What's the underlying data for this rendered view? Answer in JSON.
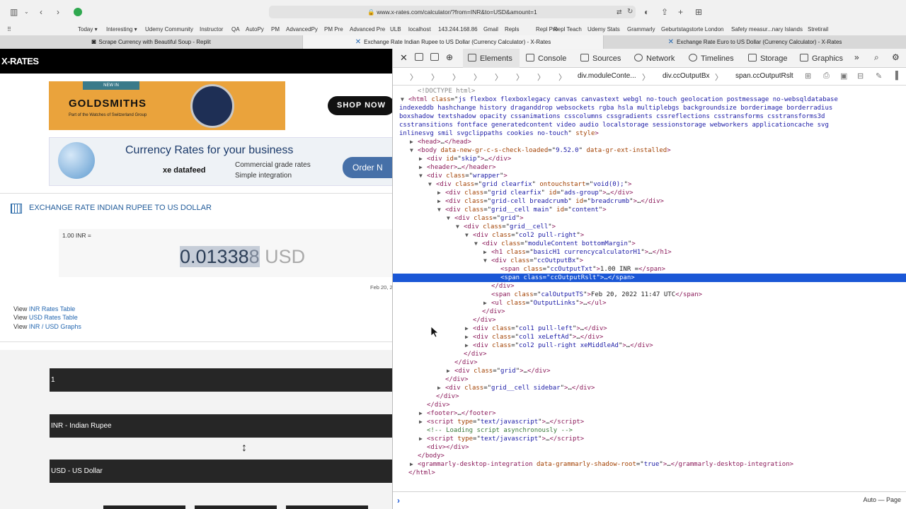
{
  "browser": {
    "url": "www.x-rates.com/calculator/?from=INR&to=USD&amount=1",
    "bookmarks": [
      "Today",
      "Interesting",
      "Udemy Community",
      "Instructor",
      "QA",
      "AutoPy",
      "PM",
      "AdvancedPy",
      "PM Pre",
      "Advanced Pre",
      "ULB",
      "localhost",
      "143.244.168.86",
      "Gmail",
      "Repls",
      "Repl Pro",
      "Repl Teach",
      "Udemy Stats",
      "Grammarly",
      "Geburtstagstorte London",
      "Safety measur...nary Islands",
      "Stretirail"
    ],
    "tabs": [
      {
        "title": "Scrape Currency with Beautiful Soup - Replit"
      },
      {
        "title": "Exchange Rate Indian Rupee to US Dollar (Currency Calculator) - X-Rates"
      },
      {
        "title": "Exchange Rate Euro to US Dollar (Currency Calculator) - X-Rates"
      }
    ]
  },
  "page": {
    "logo": "X-RATES",
    "ad1": {
      "newin": "NEW IN",
      "brand": "GOLDSMITHS",
      "sub": "Part of the Watches of Switzerland Group",
      "cta": "SHOP NOW"
    },
    "ad2": {
      "title": "Currency Rates for your business",
      "brand": "xe datafeed",
      "bullet1": "Commercial grade rates",
      "bullet2": "Simple integration",
      "cta": "Order N"
    },
    "title": "EXCHANGE RATE INDIAN RUPEE TO US DOLLAR",
    "output_txt": "1.00 INR =",
    "output_value_main": "0.01338",
    "output_value_tail": "8",
    "output_currency": "USD",
    "timestamp": "Feb 20, 2",
    "links": [
      {
        "prefix": "View ",
        "text": "INR Rates Table"
      },
      {
        "prefix": "View ",
        "text": "USD Rates Table"
      },
      {
        "prefix": "View ",
        "text": "INR / USD Graphs"
      }
    ],
    "amount": "1",
    "from": "INR - Indian Rupee",
    "to": "USD - US Dollar"
  },
  "devtools": {
    "tabs": [
      "Elements",
      "Console",
      "Sources",
      "Network",
      "Timelines",
      "Storage",
      "Graphics"
    ],
    "breadcrumbs": [
      "div.moduleConte...",
      "div.ccOutputBx",
      "span.ccOutputRslt"
    ],
    "console_mode": "Auto — Page",
    "dom_lines": [
      {
        "indent": 2,
        "tri": "",
        "html": "<span class='dt'>&lt;!DOCTYPE html&gt;</span>"
      },
      {
        "indent": 1,
        "tri": "▼",
        "html": "<span class='tg'>&lt;html</span> <span class='at'>class</span>=\"<span class='av'>js flexbox flexboxlegacy canvas canvastext webgl no-touch geolocation postmessage no-websqldatabase</span>"
      },
      {
        "indent": 0,
        "tri": "",
        "html": "<span class='av'>indexeddb hashchange history draganddrop websockets rgba hsla multiplebgs backgroundsize borderimage borderradius</span>"
      },
      {
        "indent": 0,
        "tri": "",
        "html": "<span class='av'>boxshadow textshadow opacity cssanimations csscolumns cssgradients cssreflections csstransforms csstransforms3d</span>"
      },
      {
        "indent": 0,
        "tri": "",
        "html": "<span class='av'>csstransitions fontface generatedcontent video audio localstorage sessionstorage webworkers applicationcache svg</span>"
      },
      {
        "indent": 0,
        "tri": "",
        "html": "<span class='av'>inlinesvg smil svgclippaths cookies no-touch</span>\" <span class='at'>style</span><span class='tg'>&gt;</span>"
      },
      {
        "indent": 2,
        "tri": "▶",
        "html": "<span class='tg'>&lt;head&gt;</span>…<span class='tg'>&lt;/head&gt;</span>"
      },
      {
        "indent": 2,
        "tri": "▼",
        "html": "<span class='tg'>&lt;body</span> <span class='at'>data-new-gr-c-s-check-loaded</span>=\"<span class='av'>9.52.0</span>\" <span class='at'>data-gr-ext-installed</span><span class='tg'>&gt;</span>"
      },
      {
        "indent": 3,
        "tri": "▶",
        "html": "<span class='tg'>&lt;div</span> <span class='at'>id</span>=\"<span class='av'>skip</span>\"<span class='tg'>&gt;</span>…<span class='tg'>&lt;/div&gt;</span>"
      },
      {
        "indent": 3,
        "tri": "▶",
        "html": "<span class='tg'>&lt;header&gt;</span>…<span class='tg'>&lt;/header&gt;</span>"
      },
      {
        "indent": 3,
        "tri": "▼",
        "html": "<span class='tg'>&lt;div</span> <span class='at'>class</span>=\"<span class='av'>wrapper</span>\"<span class='tg'>&gt;</span>"
      },
      {
        "indent": 4,
        "tri": "▼",
        "html": "<span class='tg'>&lt;div</span> <span class='at'>class</span>=\"<span class='av'>grid clearfix</span>\" <span class='at'>ontouchstart</span>=\"<span class='av'>void(0);</span>\"<span class='tg'>&gt;</span>"
      },
      {
        "indent": 5,
        "tri": "▶",
        "html": "<span class='tg'>&lt;div</span> <span class='at'>class</span>=\"<span class='av'>grid clearfix</span>\" <span class='at'>id</span>=\"<span class='av'>ads-group</span>\"<span class='tg'>&gt;</span>…<span class='tg'>&lt;/div&gt;</span>"
      },
      {
        "indent": 5,
        "tri": "▶",
        "html": "<span class='tg'>&lt;div</span> <span class='at'>class</span>=\"<span class='av'>grid-cell breadcrumb</span>\" <span class='at'>id</span>=\"<span class='av'>breadcrumb</span>\"<span class='tg'>&gt;</span>…<span class='tg'>&lt;/div&gt;</span>"
      },
      {
        "indent": 5,
        "tri": "▼",
        "html": "<span class='tg'>&lt;div</span> <span class='at'>class</span>=\"<span class='av'>grid__cell main</span>\" <span class='at'>id</span>=\"<span class='av'>content</span>\"<span class='tg'>&gt;</span>"
      },
      {
        "indent": 6,
        "tri": "▼",
        "html": "<span class='tg'>&lt;div</span> <span class='at'>class</span>=\"<span class='av'>grid</span>\"<span class='tg'>&gt;</span>"
      },
      {
        "indent": 7,
        "tri": "▼",
        "html": "<span class='tg'>&lt;div</span> <span class='at'>class</span>=\"<span class='av'>grid__cell</span>\"<span class='tg'>&gt;</span>"
      },
      {
        "indent": 8,
        "tri": "▼",
        "html": "<span class='tg'>&lt;div</span> <span class='at'>class</span>=\"<span class='av'>col2 pull-right</span>\"<span class='tg'>&gt;</span>"
      },
      {
        "indent": 9,
        "tri": "▼",
        "html": "<span class='tg'>&lt;div</span> <span class='at'>class</span>=\"<span class='av'>moduleContent bottomMargin</span>\"<span class='tg'>&gt;</span>"
      },
      {
        "indent": 10,
        "tri": "▶",
        "html": "<span class='tg'>&lt;h1</span> <span class='at'>class</span>=\"<span class='av'>basicH1 currencycalculatorH1</span>\"<span class='tg'>&gt;</span>…<span class='tg'>&lt;/h1&gt;</span>"
      },
      {
        "indent": 10,
        "tri": "▼",
        "html": "<span class='tg'>&lt;div</span> <span class='at'>class</span>=\"<span class='av'>ccOutputBx</span>\"<span class='tg'>&gt;</span>"
      },
      {
        "indent": 11,
        "tri": "",
        "html": "<span class='tg'>&lt;span</span> <span class='at'>class</span>=\"<span class='av'>ccOutputTxt</span>\"<span class='tg'>&gt;</span>1.00 INR =<span class='tg'>&lt;/span&gt;</span>"
      },
      {
        "indent": 11,
        "tri": "",
        "sel": true,
        "html": "<span class='tg'>&lt;span</span> <span class='at'>class</span>=\"<span class='av'>ccOutputRslt</span>\"<span class='tg'>&gt;</span>…<span class='tg'>&lt;/span&gt;</span>"
      },
      {
        "indent": 10,
        "tri": "",
        "html": "<span class='tg'>&lt;/div&gt;</span>"
      },
      {
        "indent": 10,
        "tri": "",
        "html": "<span class='tg'>&lt;span</span> <span class='at'>class</span>=\"<span class='av'>calOutputTS</span>\"<span class='tg'>&gt;</span>Feb 20, 2022 11:47 UTC<span class='tg'>&lt;/span&gt;</span>"
      },
      {
        "indent": 10,
        "tri": "▶",
        "html": "<span class='tg'>&lt;ul</span> <span class='at'>class</span>=\"<span class='av'>OutputLinks</span>\"<span class='tg'>&gt;</span>…<span class='tg'>&lt;/ul&gt;</span>"
      },
      {
        "indent": 9,
        "tri": "",
        "html": "<span class='tg'>&lt;/div&gt;</span>"
      },
      {
        "indent": 8,
        "tri": "",
        "html": "<span class='tg'>&lt;/div&gt;</span>"
      },
      {
        "indent": 8,
        "tri": "▶",
        "html": "<span class='tg'>&lt;div</span> <span class='at'>class</span>=\"<span class='av'>col1 pull-left</span>\"<span class='tg'>&gt;</span>…<span class='tg'>&lt;/div&gt;</span>"
      },
      {
        "indent": 8,
        "tri": "▶",
        "html": "<span class='tg'>&lt;div</span> <span class='at'>class</span>=\"<span class='av'>col1 xeLeftAd</span>\"<span class='tg'>&gt;</span>…<span class='tg'>&lt;/div&gt;</span>"
      },
      {
        "indent": 8,
        "tri": "▶",
        "html": "<span class='tg'>&lt;div</span> <span class='at'>class</span>=\"<span class='av'>col2 pull-right xeMiddleAd</span>\"<span class='tg'>&gt;</span>…<span class='tg'>&lt;/div&gt;</span>"
      },
      {
        "indent": 7,
        "tri": "",
        "html": "<span class='tg'>&lt;/div&gt;</span>"
      },
      {
        "indent": 6,
        "tri": "",
        "html": "<span class='tg'>&lt;/div&gt;</span>"
      },
      {
        "indent": 6,
        "tri": "▶",
        "html": "<span class='tg'>&lt;div</span> <span class='at'>class</span>=\"<span class='av'>grid</span>\"<span class='tg'>&gt;</span>…<span class='tg'>&lt;/div&gt;</span>"
      },
      {
        "indent": 5,
        "tri": "",
        "html": "<span class='tg'>&lt;/div&gt;</span>"
      },
      {
        "indent": 5,
        "tri": "▶",
        "html": "<span class='tg'>&lt;div</span> <span class='at'>class</span>=\"<span class='av'>grid__cell sidebar</span>\"<span class='tg'>&gt;</span>…<span class='tg'>&lt;/div&gt;</span>"
      },
      {
        "indent": 4,
        "tri": "",
        "html": "<span class='tg'>&lt;/div&gt;</span>"
      },
      {
        "indent": 3,
        "tri": "",
        "html": "<span class='tg'>&lt;/div&gt;</span>"
      },
      {
        "indent": 3,
        "tri": "▶",
        "html": "<span class='tg'>&lt;footer&gt;</span>…<span class='tg'>&lt;/footer&gt;</span>"
      },
      {
        "indent": 3,
        "tri": "▶",
        "html": "<span class='tg'>&lt;script</span> <span class='at'>type</span>=\"<span class='av'>text/javascript</span>\"<span class='tg'>&gt;</span>…<span class='tg'>&lt;/script&gt;</span>"
      },
      {
        "indent": 3,
        "tri": "",
        "html": "<span class='cm'>&lt;!-- Loading script asynchronously --&gt;</span>"
      },
      {
        "indent": 3,
        "tri": "▶",
        "html": "<span class='tg'>&lt;script</span> <span class='at'>type</span>=\"<span class='av'>text/javascript</span>\"<span class='tg'>&gt;</span>…<span class='tg'>&lt;/script&gt;</span>"
      },
      {
        "indent": 3,
        "tri": "",
        "html": "<span class='tg'>&lt;div&gt;&lt;/div&gt;</span>"
      },
      {
        "indent": 2,
        "tri": "",
        "html": "<span class='tg'>&lt;/body&gt;</span>"
      },
      {
        "indent": 2,
        "tri": "▶",
        "html": "<span class='tg'>&lt;grammarly-desktop-integration</span> <span class='at'>data-grammarly-shadow-root</span>=\"<span class='av'>true</span>\"<span class='tg'>&gt;</span>…<span class='tg'>&lt;/grammarly-desktop-integration&gt;</span>"
      },
      {
        "indent": 1,
        "tri": "",
        "html": "<span class='tg'>&lt;/html&gt;</span>"
      }
    ]
  }
}
